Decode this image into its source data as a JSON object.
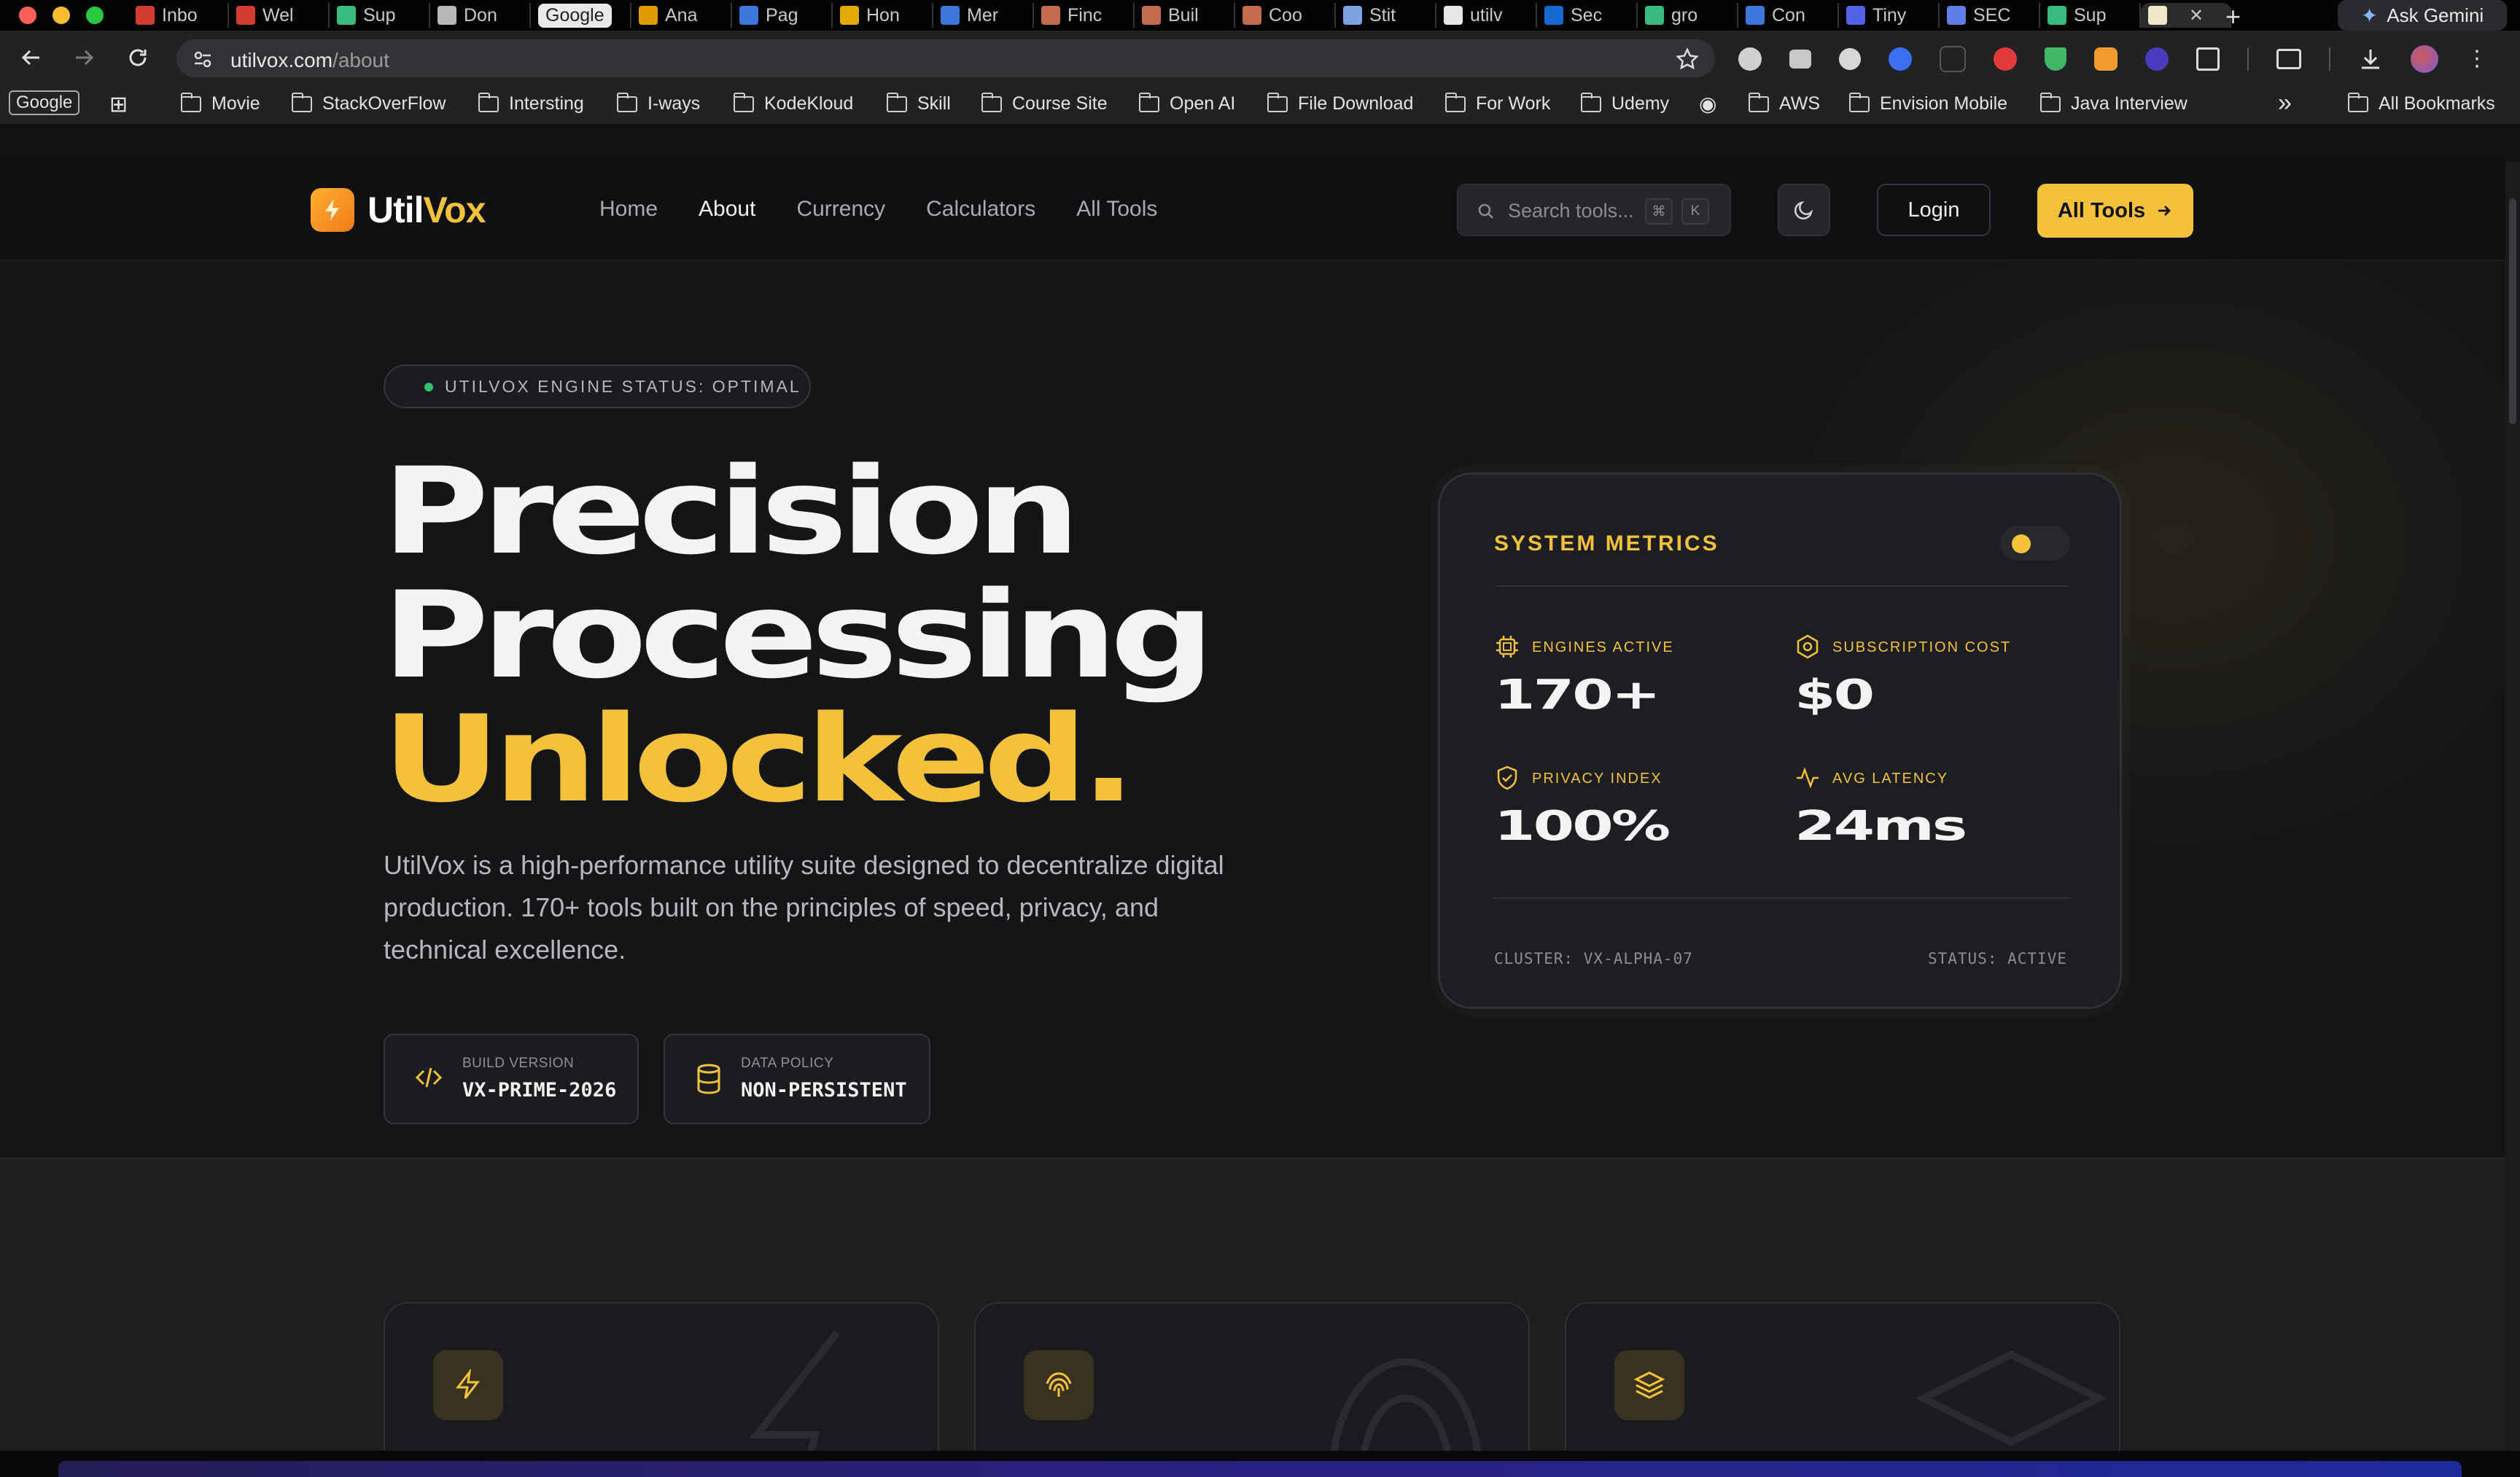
{
  "browser": {
    "tabs": [
      {
        "label": "Inbo",
        "icon": "gmail-icon",
        "color": "#ea4335"
      },
      {
        "label": "Wel",
        "icon": "gmail-icon",
        "color": "#ea4335"
      },
      {
        "label": "Sup",
        "icon": "supabase-icon",
        "color": "#3ecf8e"
      },
      {
        "label": "Don",
        "icon": "rupee-icon",
        "color": "#cccccc"
      },
      {
        "label": "Google",
        "icon": "google-pill",
        "color": "#e9e9e9"
      },
      {
        "label": "Ana",
        "icon": "analytics-icon",
        "color": "#f9ab00"
      },
      {
        "label": "Pag",
        "icon": "pagespeed-icon",
        "color": "#4285f4"
      },
      {
        "label": "Hon",
        "icon": "ads-icon",
        "color": "#fbbc04"
      },
      {
        "label": "Mer",
        "icon": "merchant-icon",
        "color": "#4285f4"
      },
      {
        "label": "Finc",
        "icon": "claude-icon",
        "color": "#d97757"
      },
      {
        "label": "Buil",
        "icon": "claude-icon",
        "color": "#d97757"
      },
      {
        "label": "Coo",
        "icon": "claude-icon",
        "color": "#d97757"
      },
      {
        "label": "Stit",
        "icon": "stitch-icon",
        "color": "#8ab4f8"
      },
      {
        "label": "utilv",
        "icon": "vercel-icon",
        "color": "#ffffff"
      },
      {
        "label": "Sec",
        "icon": "sec-icon",
        "color": "#1a73e8"
      },
      {
        "label": "gro",
        "icon": "openai-icon",
        "color": "#3ecf8e"
      },
      {
        "label": "Con",
        "icon": "console-icon",
        "color": "#4285f4"
      },
      {
        "label": "Tiny",
        "icon": "tiny-icon",
        "color": "#5b6cff"
      },
      {
        "label": "SEC",
        "icon": "link-icon",
        "color": "#6c8cff"
      },
      {
        "label": "Sup",
        "icon": "supabase-icon",
        "color": "#3ecf8e"
      }
    ],
    "active_tab_close": "✕",
    "new_tab": "+",
    "ask_gemini": "Ask Gemini",
    "url_host": "utilvox.com",
    "url_path": "/about",
    "bookmarks": [
      "Google",
      "Movie",
      "StackOverFlow",
      "Intersting",
      "I-ways",
      "KodeKloud",
      "Skill",
      "Course Site",
      "Open AI",
      "File Download",
      "For Work",
      "Udemy",
      "AWS",
      "Envision Mobile",
      "Java Interview"
    ],
    "more_bookmarks": "»",
    "all_bookmarks": "All Bookmarks"
  },
  "site": {
    "logo_util": "Util",
    "logo_vox": "Vox",
    "nav": [
      "Home",
      "About",
      "Currency",
      "Calculators",
      "All Tools"
    ],
    "active_nav": "About",
    "search_placeholder": "Search tools...",
    "search_kbd_1": "⌘",
    "search_kbd_2": "K",
    "login": "Login",
    "all_tools": "All Tools",
    "accent_color": "#f4c23a"
  },
  "hero": {
    "status": "UTILVOX ENGINE STATUS: OPTIMAL",
    "line1": "Precision",
    "line2": "Processing",
    "line3": "Unlocked.",
    "description": "UtilVox is a high-performance utility suite designed to decentralize digital production. 170+ tools built on the principles of speed, privacy, and technical excellence.",
    "build_label": "BUILD VERSION",
    "build_value": "VX-PRIME-2026",
    "policy_label": "DATA POLICY",
    "policy_value": "NON-PERSISTENT"
  },
  "metrics": {
    "title": "SYSTEM METRICS",
    "engines_label": "ENGINES ACTIVE",
    "engines_value": "170+",
    "cost_label": "SUBSCRIPTION COST",
    "cost_value": "$0",
    "privacy_label": "PRIVACY INDEX",
    "privacy_value": "100%",
    "latency_label": "AVG LATENCY",
    "latency_value": "24ms",
    "cluster": "CLUSTER: VX-ALPHA-07",
    "status": "STATUS: ACTIVE"
  }
}
